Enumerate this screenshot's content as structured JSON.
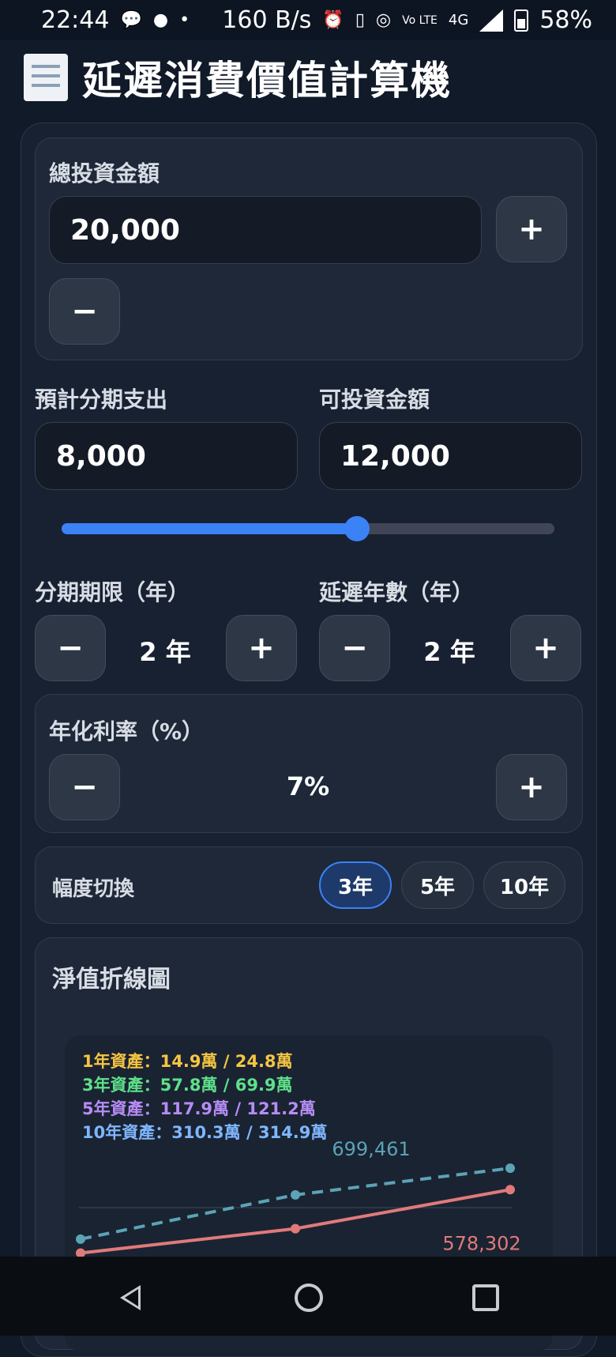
{
  "status_bar": {
    "time": "22:44",
    "net_speed": "160 B/s",
    "network": "4G",
    "volte": "Vo LTE",
    "battery": "58%",
    "app_icons": [
      "message-icon",
      "line-icon"
    ]
  },
  "app": {
    "title": "延遲消費價值計算機",
    "title_icon": "receipt-icon"
  },
  "total_investment": {
    "label": "總投資金額",
    "value": "20,000",
    "plus": "+",
    "minus": "−"
  },
  "installment_expense": {
    "label": "預計分期支出",
    "value": "8,000"
  },
  "investable_amount": {
    "label": "可投資金額",
    "value": "12,000"
  },
  "split_slider": {
    "fraction": 0.6
  },
  "installment_term": {
    "label": "分期期限（年）",
    "value": "2 年",
    "minus": "−",
    "plus": "+"
  },
  "delay_years": {
    "label": "延遲年數（年）",
    "value": "2 年",
    "minus": "−",
    "plus": "+"
  },
  "annual_rate": {
    "label": "年化利率（%）",
    "value": "7%",
    "minus": "−",
    "plus": "+"
  },
  "range_switch": {
    "label": "幅度切換",
    "options": [
      "3年",
      "5年",
      "10年"
    ],
    "selected": "3年"
  },
  "chart_section": {
    "title": "淨值折線圖",
    "legend": [
      {
        "text": "1年資產：14.9萬 / 24.8萬",
        "color": "#f5c542"
      },
      {
        "text": "3年資產：57.8萬 / 69.9萬",
        "color": "#5ee08a"
      },
      {
        "text": "5年資產：117.9萬 / 121.2萬",
        "color": "#b68cf5"
      },
      {
        "text": "10年資產：310.3萬 / 314.9萬",
        "color": "#7fb6ff"
      }
    ]
  },
  "chart_data": {
    "type": "line",
    "x": [
      1,
      2,
      3
    ],
    "series": [
      {
        "values": [
          299000,
          549000,
          699461
        ],
        "color": "#5ba3b5",
        "style": "dashed"
      },
      {
        "values": [
          220000,
          358000,
          578302
        ],
        "color": "#e07a7a",
        "style": "solid"
      }
    ],
    "annotations": [
      "699,461",
      "578,302"
    ],
    "grid": true
  }
}
